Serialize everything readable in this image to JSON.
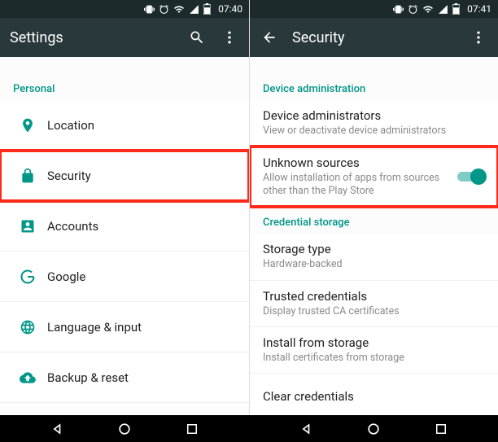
{
  "left": {
    "status_time": "07:40",
    "appbar_title": "Settings",
    "section_header": "Personal",
    "items": [
      {
        "label": "Location"
      },
      {
        "label": "Security"
      },
      {
        "label": "Accounts"
      },
      {
        "label": "Google"
      },
      {
        "label": "Language & input"
      },
      {
        "label": "Backup & reset"
      }
    ]
  },
  "right": {
    "status_time": "07:41",
    "appbar_title": "Security",
    "section1": "Device administration",
    "item1_title": "Device administrators",
    "item1_sub": "View or deactivate device administrators",
    "item2_title": "Unknown sources",
    "item2_sub": "Allow installation of apps from sources other than the Play Store",
    "section2": "Credential storage",
    "item3_title": "Storage type",
    "item3_sub": "Hardware-backed",
    "item4_title": "Trusted credentials",
    "item4_sub": "Display trusted CA certificates",
    "item5_title": "Install from storage",
    "item5_sub": "Install certificates from storage",
    "item6_title": "Clear credentials"
  }
}
